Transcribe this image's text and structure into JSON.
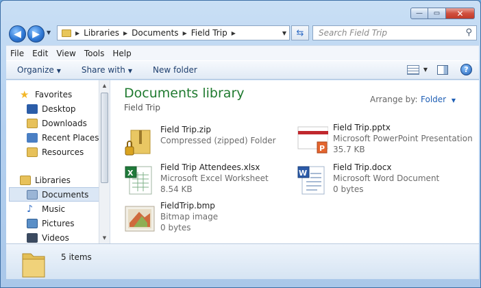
{
  "window": {
    "caption": {
      "minimize": "—",
      "maximize": "▭",
      "close": "✕"
    }
  },
  "address": {
    "crumbs": [
      "Libraries",
      "Documents",
      "Field Trip"
    ],
    "search_placeholder": "Search Field Trip"
  },
  "menu": [
    "File",
    "Edit",
    "View",
    "Tools",
    "Help"
  ],
  "commands": {
    "organize": "Organize",
    "share": "Share with",
    "new_folder": "New folder"
  },
  "navpane": {
    "items": [
      {
        "label": "Favorites",
        "icon": "star-icon",
        "color": "#f3b627"
      },
      {
        "label": "Desktop",
        "icon": "desktop-icon",
        "color": "#2b5da8"
      },
      {
        "label": "Downloads",
        "icon": "downloads-folder-icon",
        "color": "#e7c15a"
      },
      {
        "label": "Recent Places",
        "icon": "recent-places-icon",
        "color": "#4a7fc4"
      },
      {
        "label": "Resources",
        "icon": "folder-icon",
        "color": "#e7c15a"
      },
      {
        "label": "Libraries",
        "icon": "libraries-icon",
        "color": "#e7c15a"
      },
      {
        "label": "Documents",
        "icon": "documents-icon",
        "color": "#9ab5d6"
      },
      {
        "label": "Music",
        "icon": "music-icon",
        "color": "#2f6cc5"
      },
      {
        "label": "Pictures",
        "icon": "pictures-icon",
        "color": "#5a8fc7"
      },
      {
        "label": "Videos",
        "icon": "videos-icon",
        "color": "#3b4a60"
      }
    ]
  },
  "library": {
    "title": "Documents library",
    "subtitle": "Field Trip",
    "arrange_label": "Arrange by:",
    "arrange_value": "Folder"
  },
  "files": [
    {
      "name": "Field Trip.zip",
      "type": "Compressed (zipped) Folder",
      "size": "",
      "icon": "zip-folder-icon"
    },
    {
      "name": "Field Trip.pptx",
      "type": "Microsoft PowerPoint Presentation",
      "size": "35.7 KB",
      "icon": "powerpoint-icon"
    },
    {
      "name": "Field Trip Attendees.xlsx",
      "type": "Microsoft Excel Worksheet",
      "size": "8.54 KB",
      "icon": "excel-icon"
    },
    {
      "name": "Field Trip.docx",
      "type": "Microsoft Word Document",
      "size": "0 bytes",
      "icon": "word-icon"
    },
    {
      "name": "FieldTrip.bmp",
      "type": "Bitmap image",
      "size": "0 bytes",
      "icon": "bitmap-icon"
    }
  ],
  "details": {
    "count": "5 items"
  }
}
